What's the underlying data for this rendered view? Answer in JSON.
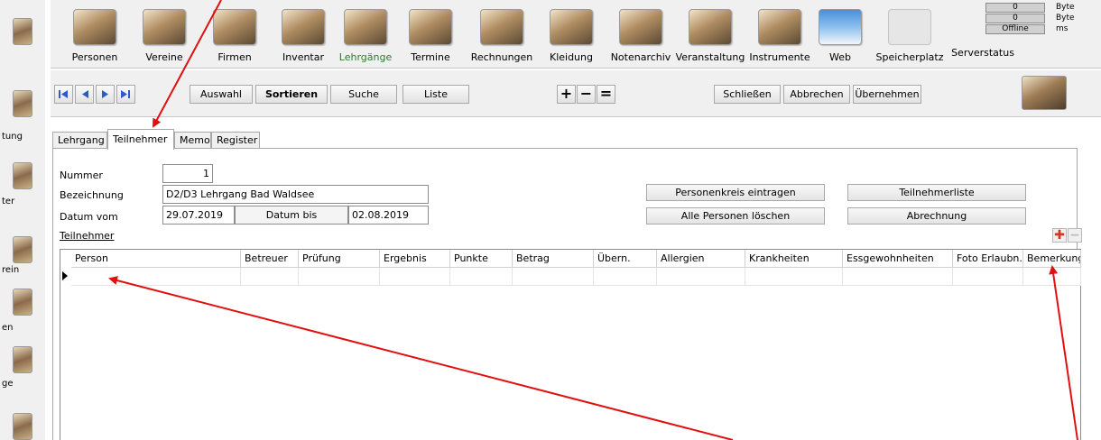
{
  "sidebar": {
    "items": [
      {
        "label": "",
        "icon": "person-module-icon"
      },
      {
        "label": "tung",
        "icon": "person-module-icon"
      },
      {
        "label": "ter",
        "icon": "person-module-icon"
      },
      {
        "label": "rein",
        "icon": "person-module-icon"
      },
      {
        "label": "en",
        "icon": "person-module-icon"
      },
      {
        "label": "ge",
        "icon": "person-module-icon"
      },
      {
        "label": "",
        "icon": "person-module-icon"
      }
    ]
  },
  "modules": [
    {
      "label": "Personen"
    },
    {
      "label": "Vereine"
    },
    {
      "label": "Firmen"
    },
    {
      "label": "Inventar"
    },
    {
      "label": "Lehrgänge",
      "active": true
    },
    {
      "label": "Termine"
    },
    {
      "label": "Rechnungen"
    },
    {
      "label": "Kleidung"
    },
    {
      "label": "Notenarchiv"
    },
    {
      "label": "Veranstaltung"
    },
    {
      "label": "Instrumente"
    },
    {
      "label": "Web"
    },
    {
      "label": "Speicherplatz"
    },
    {
      "label": "Serverstatus"
    }
  ],
  "status": {
    "rows": [
      {
        "value": "0",
        "unit": "Byte"
      },
      {
        "value": "0",
        "unit": "Byte"
      },
      {
        "value": "Offline",
        "unit": "ms"
      }
    ]
  },
  "navbar": {
    "auswahl": "Auswahl",
    "sortieren": "Sortieren",
    "suche": "Suche",
    "liste": "Liste",
    "plus": "+",
    "minus": "−",
    "equals": "=",
    "schliessen": "Schließen",
    "abbrechen": "Abbrechen",
    "uebernehmen": "Übernehmen"
  },
  "tabs": [
    "Lehrgang",
    "Teilnehmer",
    "Memo",
    "Register"
  ],
  "form": {
    "nummer_label": "Nummer",
    "nummer_value": "1",
    "bezeichnung_label": "Bezeichnung",
    "bezeichnung_value": "D2/D3 Lehrgang Bad Waldsee",
    "datum_vom_label": "Datum vom",
    "datum_vom_value": "29.07.2019",
    "datum_bis_label": "Datum bis",
    "datum_bis_value": "02.08.2019",
    "teilnehmer_label": "Teilnehmer"
  },
  "actions": {
    "personenkreis": "Personenkreis eintragen",
    "alle_loeschen": "Alle Personen löschen",
    "teilnehmerliste": "Teilnehmerliste",
    "abrechnung": "Abrechnung"
  },
  "grid": {
    "columns": [
      "Person",
      "Betreuer",
      "Prüfung",
      "Ergebnis",
      "Punkte",
      "Betrag",
      "Übern.",
      "Allergien",
      "Krankheiten",
      "Essgewohnheiten",
      "Foto Erlaubn.",
      "Bemerkung"
    ]
  },
  "colors": {
    "active_module": "#2d7a2d",
    "annotation_arrow": "#e01010",
    "add_icon": "#d9341e"
  }
}
